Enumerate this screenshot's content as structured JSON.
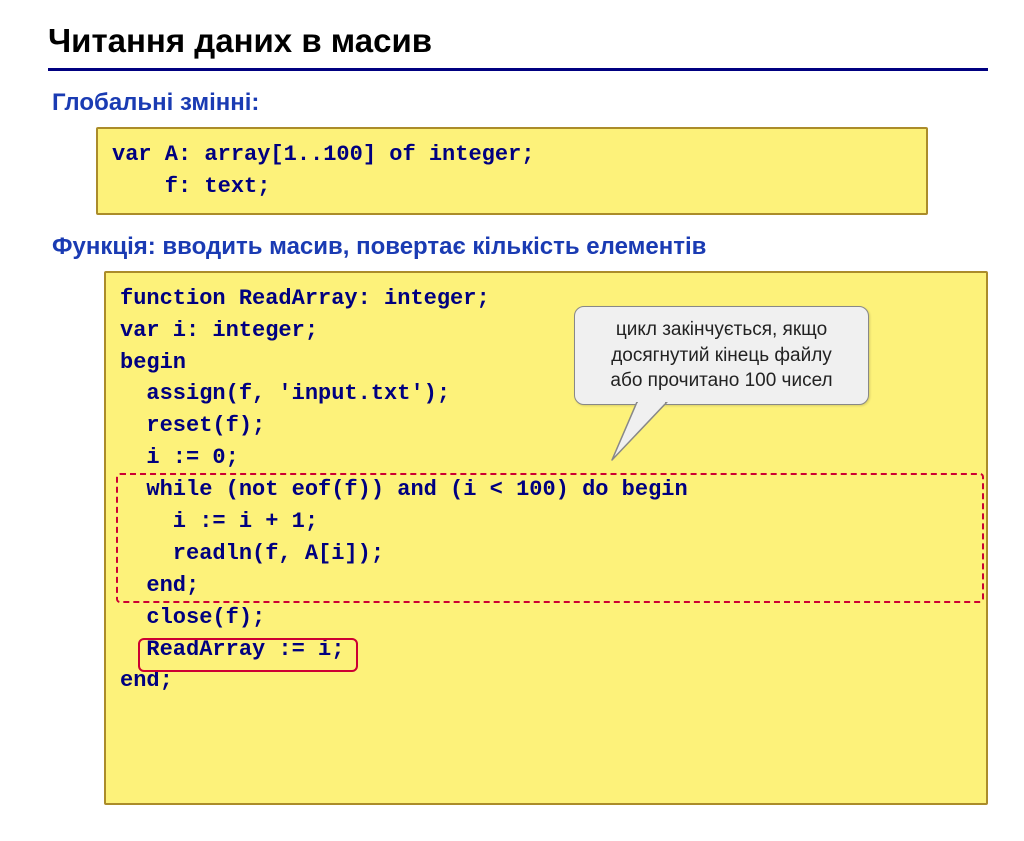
{
  "title": "Читання даних в масив",
  "section1": "Глобальні змінні:",
  "code1": "var A: array[1..100] of integer;\n    f: text;",
  "section2": "Функція: вводить масив, повертає кількість елементів",
  "code2": "function ReadArray: integer;\nvar i: integer;\nbegin\n  assign(f, 'input.txt');\n  reset(f);\n  i := 0;\n  while (not eof(f)) and (i < 100) do begin\n    i := i + 1;\n    readln(f, A[i]);\n  end;\n  close(f);\n  ReadArray := i;\nend;",
  "callout": "цикл закінчується, якщо\nдосягнутий кінець файлу\nабо прочитано 100 чисел"
}
